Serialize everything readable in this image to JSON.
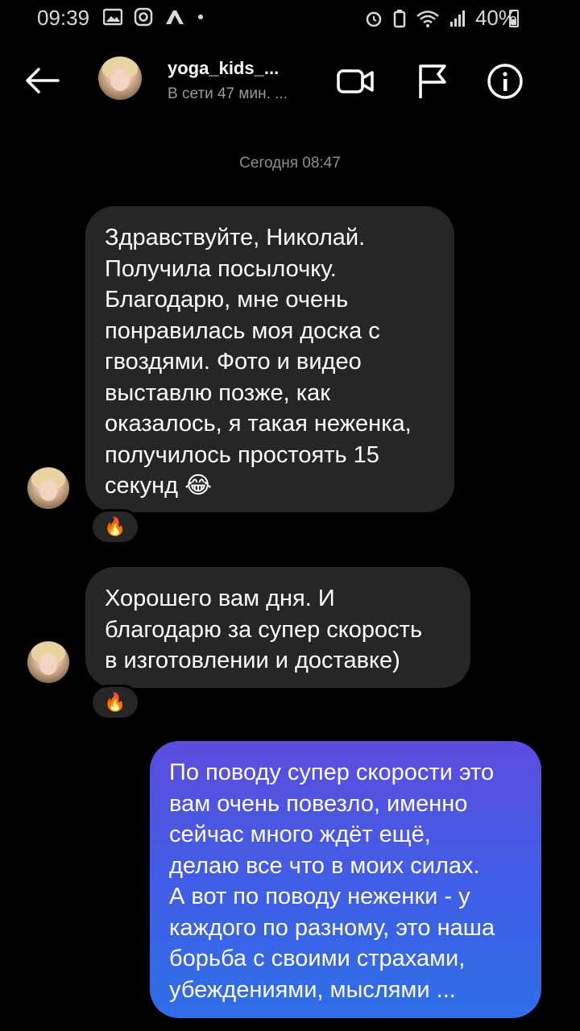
{
  "status_bar": {
    "time": "09:39",
    "battery": "40%"
  },
  "header": {
    "username": "yoga_kids_...",
    "status": "В сети 47 мин. ...",
    "icons": [
      "back-arrow-icon",
      "video-camera-icon",
      "flag-icon",
      "info-icon"
    ]
  },
  "date_separator": "Сегодня 08:47",
  "messages": [
    {
      "direction": "incoming",
      "lines": [
        "Здравствуйте, Николай.",
        "Получила посылочку.",
        "Благодарю, мне очень",
        "понравилась моя доска с",
        "гвоздями. Фото и видео",
        "выставлю позже, как",
        "оказалось, я такая неженка,",
        "получилось простоять 15",
        "секунд 😂"
      ],
      "reaction": "🔥"
    },
    {
      "direction": "incoming",
      "lines": [
        "Хорошего вам дня. И",
        "благодарю за супер скорость",
        "в изготовлении и доставке)"
      ],
      "reaction": "🔥"
    },
    {
      "direction": "outgoing",
      "lines": [
        "По поводу супер скорости это",
        "вам очень повезло, именно",
        "сейчас много ждёт ещё,",
        "делаю все что в моих силах.",
        "А вот по поводу неженки - у",
        "каждого по разному, это наша",
        "борьба с своими страхами,",
        "убеждениями, мыслями ..."
      ]
    }
  ]
}
